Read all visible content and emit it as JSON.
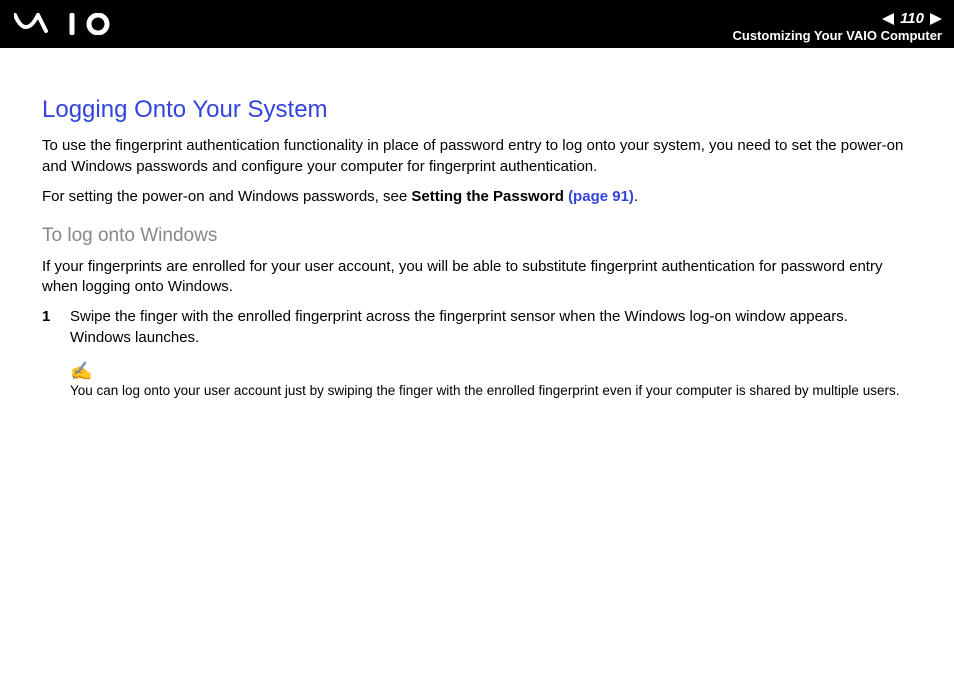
{
  "header": {
    "page_number": "110",
    "section": "Customizing Your VAIO Computer"
  },
  "body": {
    "title": "Logging Onto Your System",
    "intro_1": "To use the fingerprint authentication functionality in place of password entry to log onto your system, you need to set the power-on and Windows passwords and configure your computer for fingerprint authentication.",
    "intro_2a": "For setting the power-on and Windows passwords, see ",
    "intro_2b_bold": "Setting the Password ",
    "intro_2c_link": "(page 91)",
    "intro_2d": ".",
    "subheading": "To log onto Windows",
    "sub_intro": "If your fingerprints are enrolled for your user account, you will be able to substitute fingerprint authentication for password entry when logging onto Windows.",
    "step": {
      "num": "1",
      "text": "Swipe the finger with the enrolled fingerprint across the fingerprint sensor when the Windows log-on window appears. Windows launches."
    },
    "note": {
      "icon": "✍",
      "text": "You can log onto your user account just by swiping the finger with the enrolled fingerprint even if your computer is shared by multiple users."
    }
  }
}
